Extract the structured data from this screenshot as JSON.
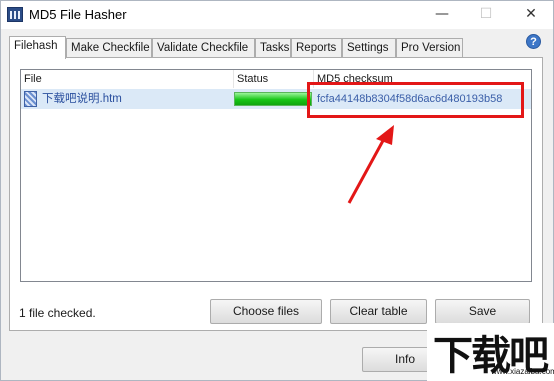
{
  "window": {
    "title": "MD5 File Hasher",
    "controls": {
      "minimize": "—",
      "maximize": "☐",
      "close": "✕"
    }
  },
  "tabs": [
    {
      "label": "Filehash",
      "active": true
    },
    {
      "label": "Make Checkfile",
      "active": false
    },
    {
      "label": "Validate Checkfile",
      "active": false
    },
    {
      "label": "Tasks",
      "active": false
    },
    {
      "label": "Reports",
      "active": false
    },
    {
      "label": "Settings",
      "active": false
    },
    {
      "label": "Pro Version",
      "active": false
    }
  ],
  "help_icon": "?",
  "table": {
    "columns": [
      "File",
      "Status",
      "MD5 checksum"
    ],
    "rows": [
      {
        "file": "下载吧说明.htm",
        "status_progress": 1.0,
        "md5": "fcfa44148b8304f58d6ac6d480193b58"
      }
    ]
  },
  "status_text": "1 file checked.",
  "buttons": {
    "choose_files": "Choose files",
    "clear_table": "Clear table",
    "save": "Save",
    "info": "Info"
  },
  "annotation": {
    "highlight_color": "#e31717"
  },
  "watermark": {
    "text": "下载吧",
    "url": "www.xiazaiba.com"
  },
  "colors": {
    "selected_row": "#dbe9f7",
    "progress_green": "#17c617",
    "link_blue": "#3a5ea8"
  }
}
